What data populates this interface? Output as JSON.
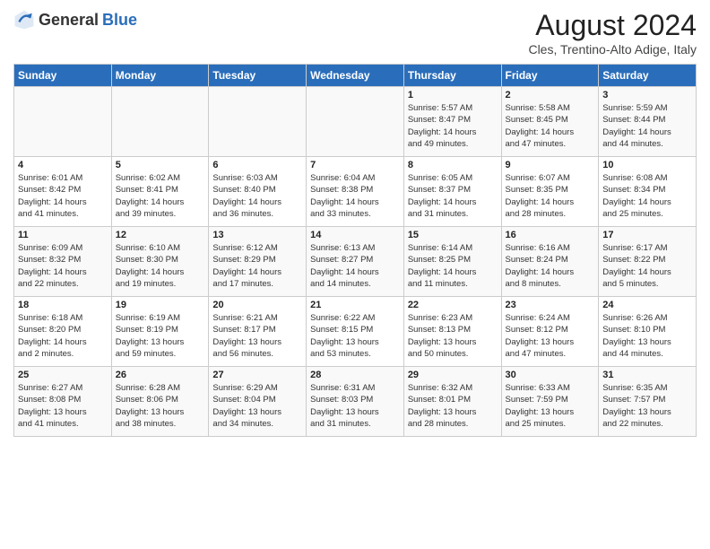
{
  "header": {
    "logo_general": "General",
    "logo_blue": "Blue",
    "month_year": "August 2024",
    "location": "Cles, Trentino-Alto Adige, Italy"
  },
  "days_of_week": [
    "Sunday",
    "Monday",
    "Tuesday",
    "Wednesday",
    "Thursday",
    "Friday",
    "Saturday"
  ],
  "weeks": [
    [
      {
        "day": "",
        "info": ""
      },
      {
        "day": "",
        "info": ""
      },
      {
        "day": "",
        "info": ""
      },
      {
        "day": "",
        "info": ""
      },
      {
        "day": "1",
        "info": "Sunrise: 5:57 AM\nSunset: 8:47 PM\nDaylight: 14 hours\nand 49 minutes."
      },
      {
        "day": "2",
        "info": "Sunrise: 5:58 AM\nSunset: 8:45 PM\nDaylight: 14 hours\nand 47 minutes."
      },
      {
        "day": "3",
        "info": "Sunrise: 5:59 AM\nSunset: 8:44 PM\nDaylight: 14 hours\nand 44 minutes."
      }
    ],
    [
      {
        "day": "4",
        "info": "Sunrise: 6:01 AM\nSunset: 8:42 PM\nDaylight: 14 hours\nand 41 minutes."
      },
      {
        "day": "5",
        "info": "Sunrise: 6:02 AM\nSunset: 8:41 PM\nDaylight: 14 hours\nand 39 minutes."
      },
      {
        "day": "6",
        "info": "Sunrise: 6:03 AM\nSunset: 8:40 PM\nDaylight: 14 hours\nand 36 minutes."
      },
      {
        "day": "7",
        "info": "Sunrise: 6:04 AM\nSunset: 8:38 PM\nDaylight: 14 hours\nand 33 minutes."
      },
      {
        "day": "8",
        "info": "Sunrise: 6:05 AM\nSunset: 8:37 PM\nDaylight: 14 hours\nand 31 minutes."
      },
      {
        "day": "9",
        "info": "Sunrise: 6:07 AM\nSunset: 8:35 PM\nDaylight: 14 hours\nand 28 minutes."
      },
      {
        "day": "10",
        "info": "Sunrise: 6:08 AM\nSunset: 8:34 PM\nDaylight: 14 hours\nand 25 minutes."
      }
    ],
    [
      {
        "day": "11",
        "info": "Sunrise: 6:09 AM\nSunset: 8:32 PM\nDaylight: 14 hours\nand 22 minutes."
      },
      {
        "day": "12",
        "info": "Sunrise: 6:10 AM\nSunset: 8:30 PM\nDaylight: 14 hours\nand 19 minutes."
      },
      {
        "day": "13",
        "info": "Sunrise: 6:12 AM\nSunset: 8:29 PM\nDaylight: 14 hours\nand 17 minutes."
      },
      {
        "day": "14",
        "info": "Sunrise: 6:13 AM\nSunset: 8:27 PM\nDaylight: 14 hours\nand 14 minutes."
      },
      {
        "day": "15",
        "info": "Sunrise: 6:14 AM\nSunset: 8:25 PM\nDaylight: 14 hours\nand 11 minutes."
      },
      {
        "day": "16",
        "info": "Sunrise: 6:16 AM\nSunset: 8:24 PM\nDaylight: 14 hours\nand 8 minutes."
      },
      {
        "day": "17",
        "info": "Sunrise: 6:17 AM\nSunset: 8:22 PM\nDaylight: 14 hours\nand 5 minutes."
      }
    ],
    [
      {
        "day": "18",
        "info": "Sunrise: 6:18 AM\nSunset: 8:20 PM\nDaylight: 14 hours\nand 2 minutes."
      },
      {
        "day": "19",
        "info": "Sunrise: 6:19 AM\nSunset: 8:19 PM\nDaylight: 13 hours\nand 59 minutes."
      },
      {
        "day": "20",
        "info": "Sunrise: 6:21 AM\nSunset: 8:17 PM\nDaylight: 13 hours\nand 56 minutes."
      },
      {
        "day": "21",
        "info": "Sunrise: 6:22 AM\nSunset: 8:15 PM\nDaylight: 13 hours\nand 53 minutes."
      },
      {
        "day": "22",
        "info": "Sunrise: 6:23 AM\nSunset: 8:13 PM\nDaylight: 13 hours\nand 50 minutes."
      },
      {
        "day": "23",
        "info": "Sunrise: 6:24 AM\nSunset: 8:12 PM\nDaylight: 13 hours\nand 47 minutes."
      },
      {
        "day": "24",
        "info": "Sunrise: 6:26 AM\nSunset: 8:10 PM\nDaylight: 13 hours\nand 44 minutes."
      }
    ],
    [
      {
        "day": "25",
        "info": "Sunrise: 6:27 AM\nSunset: 8:08 PM\nDaylight: 13 hours\nand 41 minutes."
      },
      {
        "day": "26",
        "info": "Sunrise: 6:28 AM\nSunset: 8:06 PM\nDaylight: 13 hours\nand 38 minutes."
      },
      {
        "day": "27",
        "info": "Sunrise: 6:29 AM\nSunset: 8:04 PM\nDaylight: 13 hours\nand 34 minutes."
      },
      {
        "day": "28",
        "info": "Sunrise: 6:31 AM\nSunset: 8:03 PM\nDaylight: 13 hours\nand 31 minutes."
      },
      {
        "day": "29",
        "info": "Sunrise: 6:32 AM\nSunset: 8:01 PM\nDaylight: 13 hours\nand 28 minutes."
      },
      {
        "day": "30",
        "info": "Sunrise: 6:33 AM\nSunset: 7:59 PM\nDaylight: 13 hours\nand 25 minutes."
      },
      {
        "day": "31",
        "info": "Sunrise: 6:35 AM\nSunset: 7:57 PM\nDaylight: 13 hours\nand 22 minutes."
      }
    ]
  ]
}
